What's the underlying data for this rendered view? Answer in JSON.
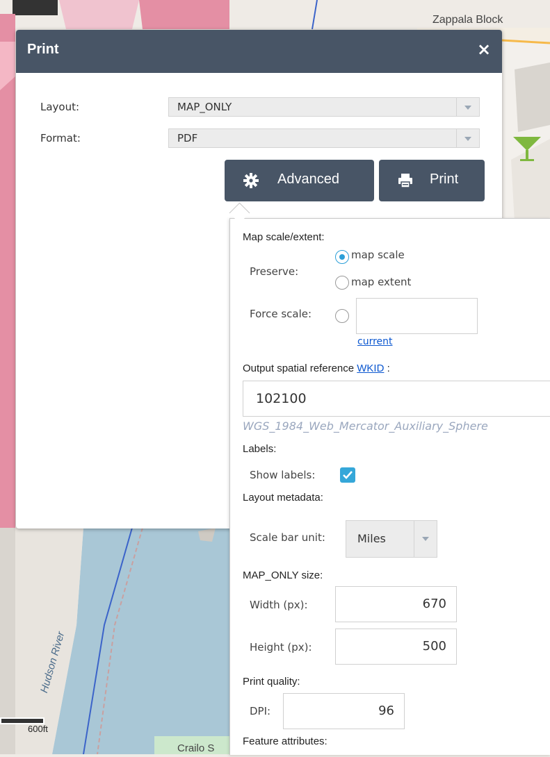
{
  "map": {
    "labels": {
      "zappala": "Zappala Block",
      "crailo": "Crailo S",
      "hudson": "Hudson River"
    },
    "scale_bar_label": "600ft"
  },
  "dialog": {
    "title": "Print",
    "close_icon": "×",
    "layout": {
      "label": "Layout:",
      "value": "MAP_ONLY"
    },
    "format": {
      "label": "Format:",
      "value": "PDF"
    },
    "advanced_button": "Advanced",
    "print_button": "Print"
  },
  "advanced": {
    "map_scale_heading": "Map scale/extent:",
    "preserve_label": "Preserve:",
    "preserve_options": [
      "map scale",
      "map extent"
    ],
    "preserve_selected": "map scale",
    "force_scale_label": "Force scale:",
    "force_scale_value": "",
    "current_link": "current",
    "output_sr_heading": "Output spatial reference",
    "wkid_link": "WKID",
    "output_sr_colon": ":",
    "wkid_value": "102100",
    "wkid_description": "WGS_1984_Web_Mercator_Auxiliary_Sphere",
    "labels_heading": "Labels:",
    "show_labels_label": "Show labels:",
    "show_labels_checked": true,
    "layout_metadata_heading": "Layout metadata:",
    "scale_bar_unit_label": "Scale bar unit:",
    "scale_bar_unit_value": "Miles",
    "map_only_size_heading": "MAP_ONLY size:",
    "width_label": "Width (px):",
    "width_value": "670",
    "height_label": "Height (px):",
    "height_value": "500",
    "print_quality_heading": "Print quality:",
    "dpi_label": "DPI:",
    "dpi_value": "96",
    "feature_attributes_heading": "Feature attributes:"
  },
  "colors": {
    "header": "#485566",
    "accent": "#2b9fd8",
    "link": "#0b57d0",
    "water": "#a9c7d6",
    "map_bg": "#efebe6"
  }
}
